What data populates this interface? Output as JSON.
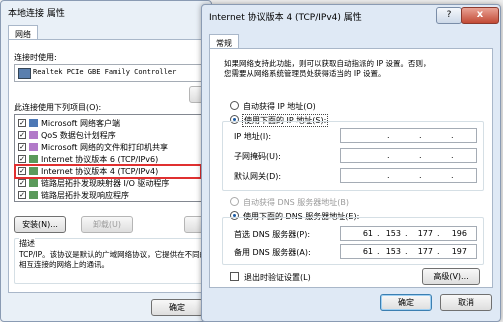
{
  "local": {
    "title": "本地连接 属性",
    "tab": "网络",
    "connect_using_label": "连接时使用:",
    "adapter": "Realtek PCIe GBE Family Controller",
    "items_label": "此连接使用下列项目(O):",
    "items": [
      "Microsoft 网络客户端",
      "QoS 数据包计划程序",
      "Microsoft 网络的文件和打印机共享",
      "Internet 协议版本 6 (TCP/IPv6)",
      "Internet 协议版本 4 (TCP/IPv4)",
      "链路层拓扑发现映射器 I/O 驱动程序",
      "链路层拓扑发现响应程序"
    ],
    "install_button": "安装(N)...",
    "uninstall_button": "卸载(U)",
    "description_label": "描述",
    "description_text": "TCP/IP。该协议是默认的广域网络协议，它提供在不同的相互连接的网络上的通讯。",
    "ok_button": "确定",
    "highlight_color": "#e03030"
  },
  "ipv4": {
    "title": "Internet 协议版本 4 (TCP/IPv4) 属性",
    "tab": "常规",
    "intro_line1": "如果网络支持此功能，则可以获取自动指派的 IP 设置。否则，",
    "intro_line2": "您需要从网络系统管理员处获得适当的 IP 设置。",
    "auto_ip": "自动获得 IP 地址(O)",
    "manual_ip": "使用下面的 IP 地址(S):",
    "ip_label": "IP 地址(I):",
    "mask_label": "子网掩码(U):",
    "gateway_label": "默认网关(D):",
    "auto_dns": "自动获得 DNS 服务器地址(B)",
    "manual_dns": "使用下面的 DNS 服务器地址(E):",
    "preferred_dns_label": "首选 DNS 服务器(P):",
    "alternate_dns_label": "备用 DNS 服务器(A):",
    "preferred_dns": [
      "61",
      "153",
      "177",
      "196"
    ],
    "alternate_dns": [
      "61",
      "153",
      "177",
      "197"
    ],
    "validate_label": "退出时验证设置(L)",
    "advanced_button": "高级(V)...",
    "ok_button": "确定",
    "cancel_button": "取消",
    "help_icon": "?",
    "close_icon": "x"
  }
}
